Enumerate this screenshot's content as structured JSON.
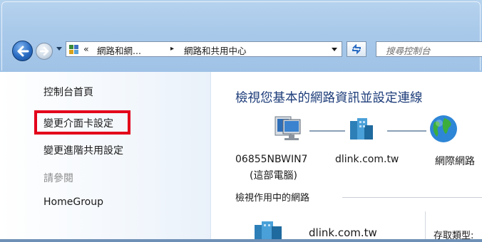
{
  "address_bar": {
    "overflow_chevron": "«",
    "crumb_parent": "網路和網...",
    "separator": "▸",
    "crumb_current": "網路和共用中心"
  },
  "search": {
    "placeholder": "搜尋控制台"
  },
  "sidebar": {
    "home": "控制台首頁",
    "change_adapter": "變更介面卡設定",
    "advanced_sharing": "變更進階共用設定",
    "see_also": "請參閱",
    "homegroup": "HomeGroup"
  },
  "main": {
    "title": "檢視您基本的網路資訊並設定連線",
    "computer_name": "06855NBWIN7",
    "computer_note": "(這部電腦)",
    "network_name": "dlink.com.tw",
    "internet": "網際網路",
    "active_networks": "檢視作用中的網路",
    "active_network_name": "dlink.com.tw",
    "access_type": "存取類型:"
  },
  "colors": {
    "title_blue": "#1e3d7a",
    "highlight_red": "#e3001b"
  },
  "icons": {
    "back": "back-arrow-icon",
    "forward": "forward-arrow-icon",
    "control_panel": "control-panel-icon",
    "refresh": "refresh-icon",
    "computer": "computer-icon",
    "network": "network-building-icon",
    "internet": "globe-icon"
  }
}
